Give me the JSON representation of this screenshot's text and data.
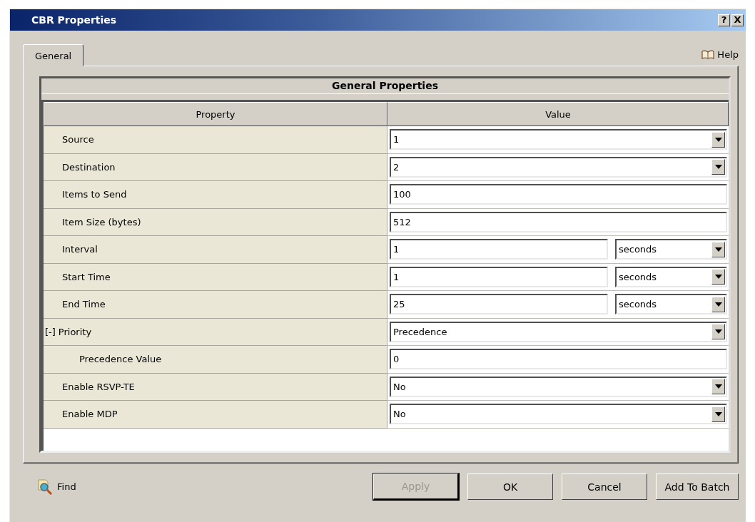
{
  "window": {
    "title": "CBR Properties",
    "title_buttons": [
      "?",
      "X"
    ]
  },
  "tabs": [
    {
      "label": "General",
      "selected": true
    }
  ],
  "help": {
    "label": "Help"
  },
  "group": {
    "title": "General Properties"
  },
  "table": {
    "columns": [
      "Property",
      "Value"
    ],
    "rows": [
      {
        "name": "Source",
        "kind": "select",
        "value": "1"
      },
      {
        "name": "Destination",
        "kind": "select",
        "value": "2"
      },
      {
        "name": "Items to Send",
        "kind": "text",
        "value": "100"
      },
      {
        "name": "Item Size (bytes)",
        "kind": "text",
        "value": "512"
      },
      {
        "name": "Interval",
        "kind": "text_unit",
        "value": "1",
        "unit": "seconds"
      },
      {
        "name": "Start Time",
        "kind": "text_unit",
        "value": "1",
        "unit": "seconds"
      },
      {
        "name": "End Time",
        "kind": "text_unit",
        "value": "25",
        "unit": "seconds"
      },
      {
        "name": "Priority",
        "kind": "select",
        "value": "Precedence",
        "toggle": "[-]",
        "expanded": true,
        "children": [
          {
            "name": "Precedence Value",
            "kind": "text",
            "value": "0"
          }
        ]
      },
      {
        "name": "Enable RSVP-TE",
        "kind": "select",
        "value": "No"
      },
      {
        "name": "Enable MDP",
        "kind": "select",
        "value": "No"
      }
    ]
  },
  "find": {
    "label": "Find"
  },
  "buttons": [
    {
      "label": "Apply",
      "disabled": true,
      "default": true
    },
    {
      "label": "OK",
      "disabled": false,
      "default": false
    },
    {
      "label": "Cancel",
      "disabled": false,
      "default": false
    },
    {
      "label": "Add To Batch",
      "disabled": false,
      "default": false
    }
  ]
}
